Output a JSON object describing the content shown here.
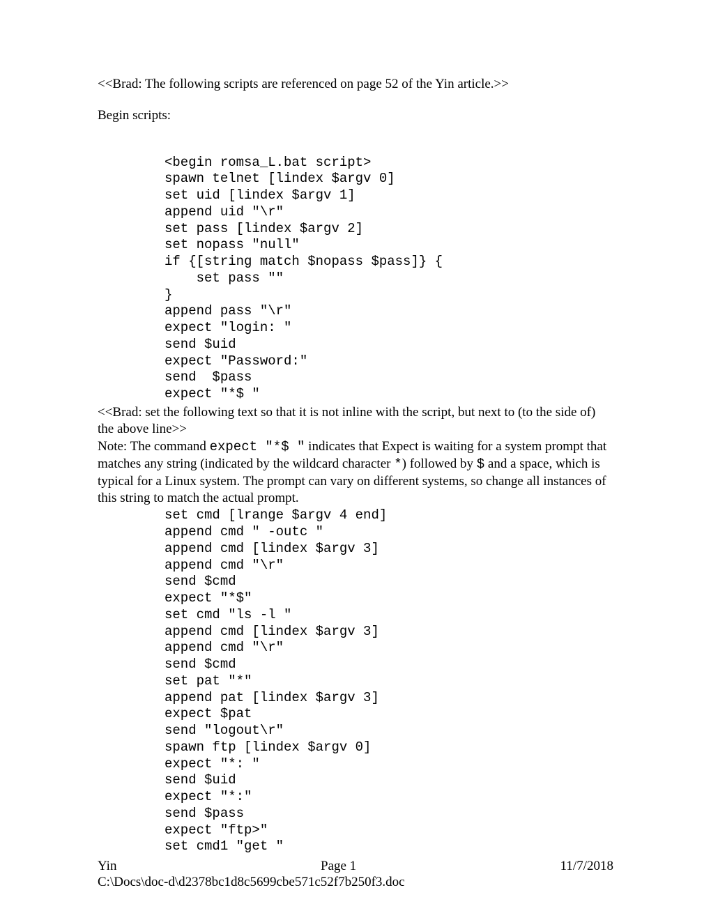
{
  "intro": "<<Brad: The following scripts are referenced on page 52 of the Yin article.>>",
  "begin": "Begin scripts:",
  "code1": "<begin romsa_L.bat script>\nspawn telnet [lindex $argv 0]\nset uid [lindex $argv 1]\nappend uid \"\\r\"\nset pass [lindex $argv 2]\nset nopass \"null\"\nif {[string match $nopass $pass]} {\n    set pass \"\"\n}\nappend pass \"\\r\"\nexpect \"login: \"\nsend $uid\nexpect \"Password:\"\nsend  $pass\nexpect \"*$ \"",
  "note_brad": "<<Brad: set the following text so that it is not inline with the script, but next to (to the side of) the above line>>",
  "note_prefix": "Note: The command ",
  "note_mono1": "expect \"*$ \"",
  "note_mid1": " indicates that Expect is waiting for a system prompt that matches any string (indicated by the wildcard character ",
  "note_mono2": "*",
  "note_mid2": ") followed by ",
  "note_mono3": "$",
  "note_tail": " and a space, which is typical for a Linux system. The prompt can vary on different systems, so change all instances of this string to match the actual prompt.",
  "code2": "set cmd [lrange $argv 4 end]\nappend cmd \" -outc \"\nappend cmd [lindex $argv 3]\nappend cmd \"\\r\"\nsend $cmd\nexpect \"*$\"\nset cmd \"ls -l \"\nappend cmd [lindex $argv 3]\nappend cmd \"\\r\"\nsend $cmd\nset pat \"*\"\nappend pat [lindex $argv 3]\nexpect $pat\nsend \"logout\\r\"\nspawn ftp [lindex $argv 0]\nexpect \"*: \"\nsend $uid\nexpect \"*:\"\nsend $pass\nexpect \"ftp>\"\nset cmd1 \"get \"",
  "footer": {
    "left": "Yin",
    "center": "Page 1",
    "right": "11/7/2018",
    "path": "C:\\Docs\\doc-d\\d2378bc1d8c5699cbe571c52f7b250f3.doc"
  }
}
